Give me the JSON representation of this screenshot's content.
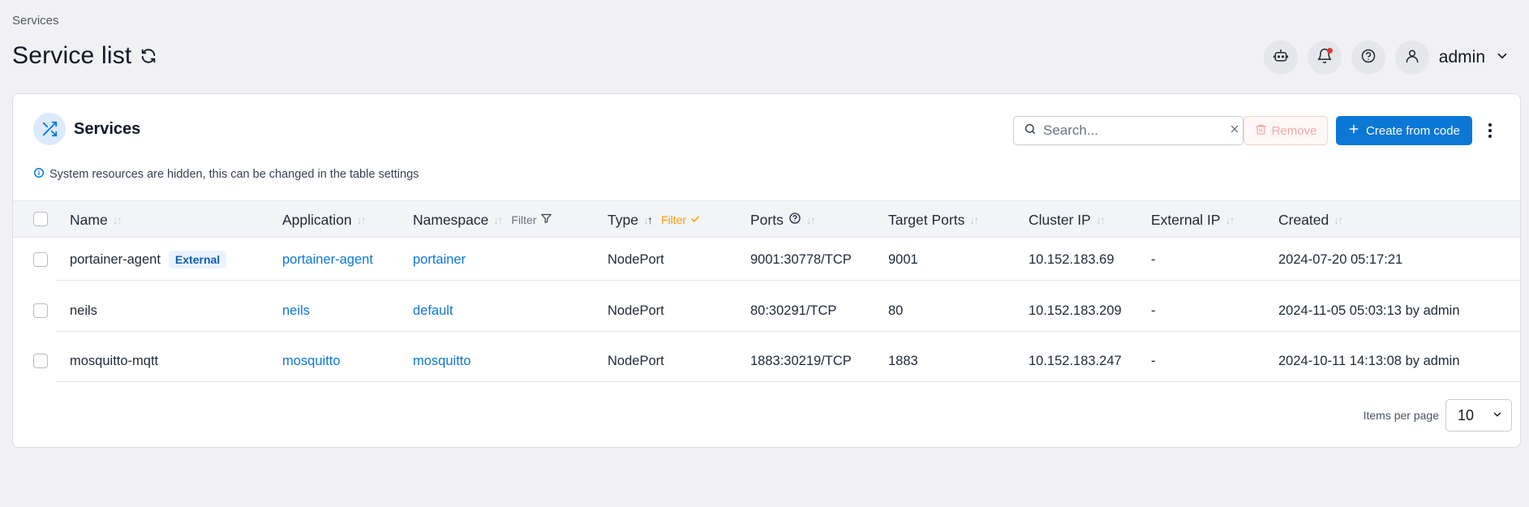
{
  "breadcrumb": "Services",
  "page_title": "Service list",
  "header": {
    "user_name": "admin"
  },
  "panel": {
    "title": "Services",
    "search_placeholder": "Search...",
    "remove_label": "Remove",
    "create_label": "Create from code",
    "info_text": "System resources are hidden, this can be changed in the table settings"
  },
  "columns": {
    "name": "Name",
    "application": "Application",
    "namespace": "Namespace",
    "namespace_filter": "Filter",
    "type": "Type",
    "type_filter": "Filter",
    "ports": "Ports",
    "target_ports": "Target Ports",
    "cluster_ip": "Cluster IP",
    "external_ip": "External IP",
    "created": "Created"
  },
  "rows": [
    {
      "name": "portainer-agent",
      "badge": "External",
      "application": "portainer-agent",
      "namespace": "portainer",
      "type": "NodePort",
      "ports": "9001:30778/TCP",
      "target_ports": "9001",
      "cluster_ip": "10.152.183.69",
      "external_ip": "-",
      "created": "2024-07-20 05:17:21"
    },
    {
      "name": "neils",
      "application": "neils",
      "namespace": "default",
      "type": "NodePort",
      "ports": "80:30291/TCP",
      "target_ports": "80",
      "cluster_ip": "10.152.183.209",
      "external_ip": "-",
      "created": "2024-11-05 05:03:13 by admin"
    },
    {
      "name": "mosquitto-mqtt",
      "application": "mosquitto",
      "namespace": "mosquitto",
      "type": "NodePort",
      "ports": "1883:30219/TCP",
      "target_ports": "1883",
      "cluster_ip": "10.152.183.247",
      "external_ip": "-",
      "created": "2024-10-11 14:13:08 by admin"
    }
  ],
  "pagination": {
    "label": "Items per page",
    "value": "10"
  },
  "colors": {
    "accent": "#0b78d5",
    "filter_active": "#f59e0b",
    "notification_dot": "#e53935"
  }
}
